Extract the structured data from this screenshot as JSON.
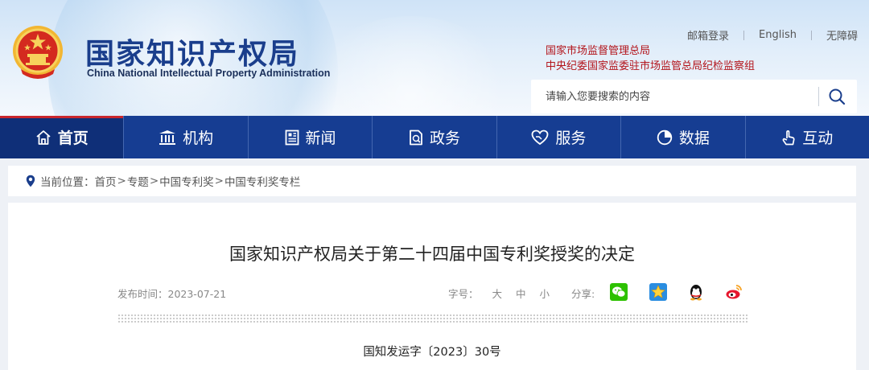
{
  "header": {
    "logo_cn": "国家知识产权局",
    "logo_en": "China National Intellectual Property Administration",
    "top_links": [
      "邮箱登录",
      "English",
      "无障碍"
    ],
    "agency_links": [
      "国家市场监督管理总局",
      "中央纪委国家监委驻市场监管总局纪检监察组"
    ],
    "search_placeholder": "请输入您要搜索的内容"
  },
  "nav": {
    "items": [
      {
        "label": "首页",
        "icon": "home-icon",
        "active": true
      },
      {
        "label": "机构",
        "icon": "institution-icon"
      },
      {
        "label": "新闻",
        "icon": "news-icon"
      },
      {
        "label": "政务",
        "icon": "government-affairs-icon"
      },
      {
        "label": "服务",
        "icon": "service-icon"
      },
      {
        "label": "数据",
        "icon": "data-pie-icon"
      },
      {
        "label": "互动",
        "icon": "interaction-icon"
      }
    ]
  },
  "breadcrumb": {
    "prefix": "当前位置：",
    "items": [
      "首页",
      "专题",
      "中国专利奖",
      "中国专利奖专栏"
    ],
    "separator": ">"
  },
  "article": {
    "title": "国家知识产权局关于第二十四届中国专利奖授奖的决定",
    "date_text": "发布时间：2023-07-21",
    "font_size_label": "字号：",
    "font_sizes": [
      "大",
      "中",
      "小"
    ],
    "share_label": "分享:",
    "share_icons": [
      "wechat-icon",
      "favorite-star-icon",
      "qq-icon",
      "weibo-icon"
    ],
    "doc_number": "国知发运字〔2023〕30号"
  },
  "colors": {
    "nav_bg": "#163d92",
    "nav_active": "#0f2f78",
    "brand_blue": "#1a3e8c",
    "agency_red": "#b3141b"
  }
}
